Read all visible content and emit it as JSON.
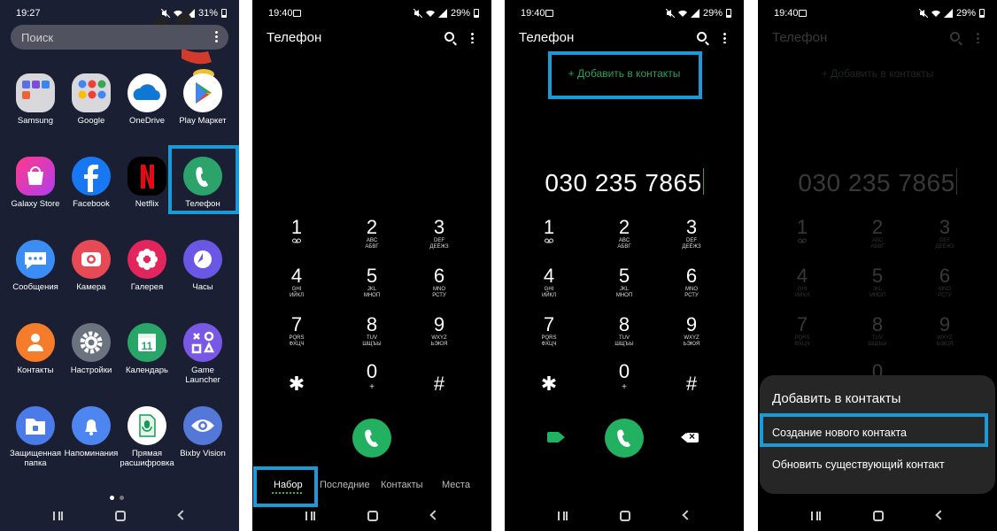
{
  "status_bar": {
    "s1": {
      "time": "19:27",
      "battery": "31%"
    },
    "s2": {
      "time": "19:40",
      "battery": "29%"
    },
    "s3": {
      "time": "19:40",
      "battery": "29%"
    },
    "s4": {
      "time": "19:40",
      "battery": "29%"
    }
  },
  "home": {
    "search_placeholder": "Поиск",
    "apps": [
      {
        "label": "Samsung",
        "icon": "samsung-folder-icon"
      },
      {
        "label": "Google",
        "icon": "google-folder-icon"
      },
      {
        "label": "OneDrive",
        "icon": "onedrive-icon"
      },
      {
        "label": "Play Маркет",
        "icon": "play-store-icon"
      },
      {
        "label": "Galaxy Store",
        "icon": "galaxy-store-icon"
      },
      {
        "label": "Facebook",
        "icon": "facebook-icon"
      },
      {
        "label": "Netflix",
        "icon": "netflix-icon"
      },
      {
        "label": "Телефон",
        "icon": "phone-icon"
      },
      {
        "label": "Сообщения",
        "icon": "messages-icon"
      },
      {
        "label": "Камера",
        "icon": "camera-icon"
      },
      {
        "label": "Галерея",
        "icon": "gallery-icon"
      },
      {
        "label": "Часы",
        "icon": "clock-icon"
      },
      {
        "label": "Контакты",
        "icon": "contacts-icon"
      },
      {
        "label": "Настройки",
        "icon": "settings-icon"
      },
      {
        "label": "Календарь",
        "icon": "calendar-icon"
      },
      {
        "label": "Game Launcher",
        "icon": "game-launcher-icon"
      },
      {
        "label": "Защищенная папка",
        "icon": "secure-folder-icon"
      },
      {
        "label": "Напоминания",
        "icon": "reminders-icon"
      },
      {
        "label": "Прямая расшифровка",
        "icon": "live-transcribe-icon"
      },
      {
        "label": "Bixby Vision",
        "icon": "bixby-vision-icon"
      }
    ],
    "calendar_day": "11",
    "highlight_app": "Телефон"
  },
  "dialer": {
    "title": "Телефон",
    "keys": [
      {
        "digit": "1",
        "sub1": "",
        "sub2": "voicemail-icon"
      },
      {
        "digit": "2",
        "sub1": "ABC",
        "sub2": "АБВГ"
      },
      {
        "digit": "3",
        "sub1": "DEF",
        "sub2": "ДЕЁЖЗ"
      },
      {
        "digit": "4",
        "sub1": "GHI",
        "sub2": "ИЙКЛ"
      },
      {
        "digit": "5",
        "sub1": "JKL",
        "sub2": "МНОП"
      },
      {
        "digit": "6",
        "sub1": "MNO",
        "sub2": "РСТУ"
      },
      {
        "digit": "7",
        "sub1": "PQRS",
        "sub2": "ФХЦЧ"
      },
      {
        "digit": "8",
        "sub1": "TUV",
        "sub2": "ШЩЪЫ"
      },
      {
        "digit": "9",
        "sub1": "WXYZ",
        "sub2": "ЬЭЮЯ"
      },
      {
        "digit": "✱",
        "sub1": "",
        "sub2": ""
      },
      {
        "digit": "0",
        "sub1": "+",
        "sub2": ""
      },
      {
        "digit": "#",
        "sub1": "",
        "sub2": ""
      }
    ],
    "tabs": [
      "Набор",
      "Последние",
      "Контакты",
      "Места"
    ],
    "add_to_contacts": "+ Добавить в контакты",
    "number": "030 235 7865"
  },
  "sheet": {
    "title": "Добавить в контакты",
    "options": [
      "Создание нового контакта",
      "Обновить существующий контакт"
    ]
  },
  "colors": {
    "highlight": "#1a9bd8",
    "green": "#22b061",
    "home_bg": "#1b1f33"
  }
}
